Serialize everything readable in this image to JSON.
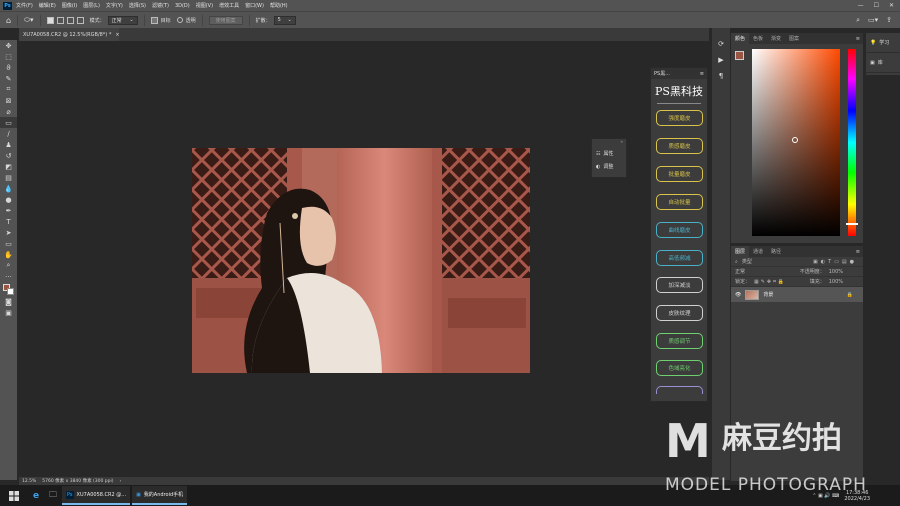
{
  "menubar": {
    "logo": "Ps",
    "items": [
      "文件(F)",
      "编辑(E)",
      "图像(I)",
      "图层(L)",
      "文字(Y)",
      "选择(S)",
      "滤镜(T)",
      "3D(D)",
      "视图(V)",
      "增效工具",
      "窗口(W)",
      "帮助(H)"
    ],
    "min": "—",
    "max": "☐",
    "close": "✕"
  },
  "options": {
    "mode_label": "模式：",
    "mode_value": "正常",
    "target_label": "目标",
    "transparent_label": "透明",
    "use_pattern": "使用图案",
    "spread_label": "扩散：",
    "spread_value": "5"
  },
  "document": {
    "tab_title": "XU7A0058.CR2 @ 12.5%(RGB/8*) *",
    "tab_close": "×"
  },
  "status": {
    "zoom": "12.5%",
    "info": "5760 像素 x 3840 像素 (300 ppi)"
  },
  "plugin": {
    "title": "PS黑...",
    "logo": "PS黑科技",
    "buttons": [
      {
        "label": "强度磨皮",
        "color": "#d9c34a"
      },
      {
        "label": "质感磨皮",
        "color": "#d9c34a"
      },
      {
        "label": "批量磨皮",
        "color": "#d9c34a"
      },
      {
        "label": "自动批量",
        "color": "#d9c34a"
      },
      {
        "label": "曲线磨皮",
        "color": "#4ab0c8"
      },
      {
        "label": "高低频减",
        "color": "#4ab0c8"
      },
      {
        "label": "加深减淡",
        "color": "#d0d0d0"
      },
      {
        "label": "皮肤纹理",
        "color": "#d0d0d0"
      },
      {
        "label": "质感调节",
        "color": "#6fd06f"
      },
      {
        "label": "色域亮化",
        "color": "#6fd06f"
      }
    ]
  },
  "mini_panel": {
    "properties": "属性",
    "adjustments": "调整"
  },
  "color_panel": {
    "tabs": [
      "颜色",
      "色板",
      "渐变",
      "图案"
    ],
    "foreground_color": "#9a5645",
    "hue_color": "#ff4a00"
  },
  "layers_panel": {
    "tabs": [
      "图层",
      "通道",
      "路径"
    ],
    "filter_label": "类型",
    "blend_mode": "正常",
    "opacity_label": "不透明度：",
    "opacity_value": "100%",
    "lock_label": "锁定：",
    "fill_label": "填充：",
    "fill_value": "100%",
    "layer_name": "背景"
  },
  "learn_panel": {
    "learn": "学习",
    "library": "库"
  },
  "taskbar": {
    "app1": "XU7A0058.CR2 @...",
    "app2": "我的Android手机",
    "time": "17:38:46",
    "date": "2022/4/23"
  },
  "watermark": {
    "letter": "M",
    "cn": "麻豆约拍",
    "en": "MODEL PHOTOGRAPH"
  }
}
